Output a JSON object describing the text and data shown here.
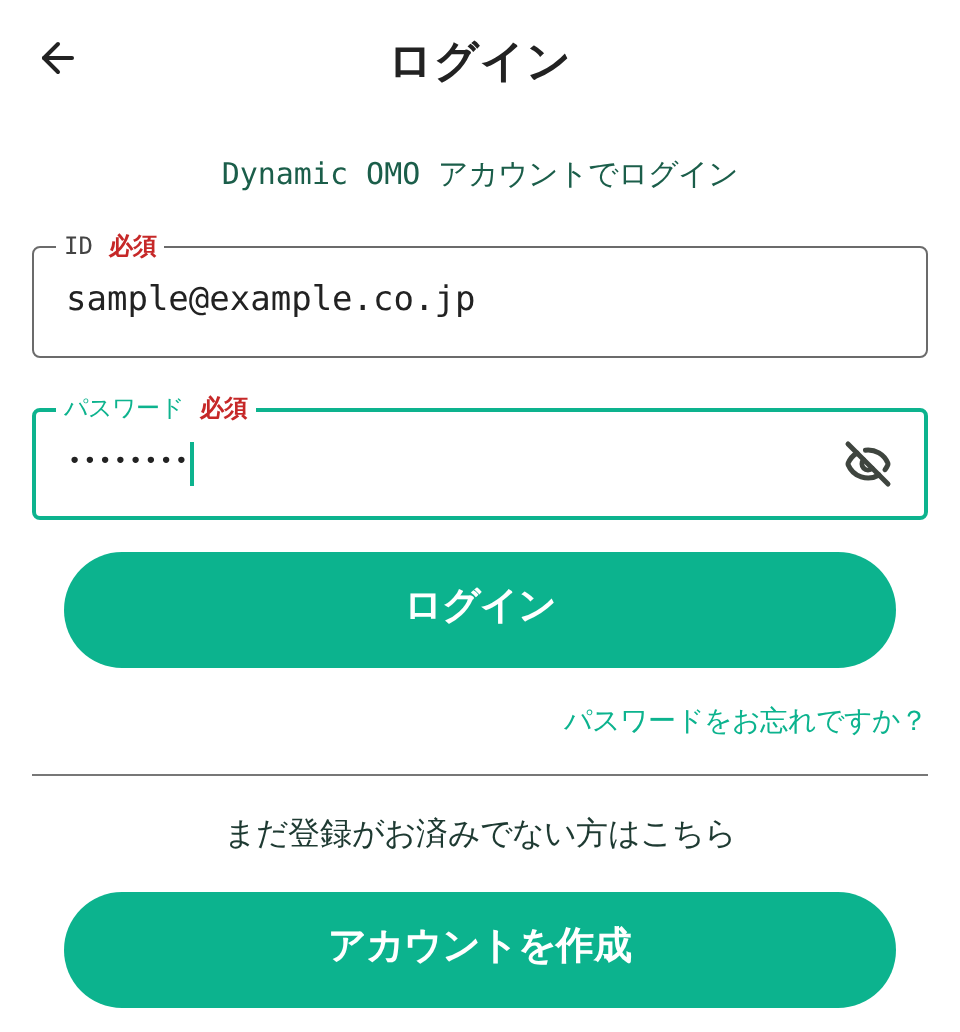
{
  "header": {
    "title": "ログイン"
  },
  "subtitle": "Dynamic OMO アカウントでログイン",
  "fields": [
    {
      "label": "ID",
      "required_mark": "必須",
      "value": "sample@example.co.jp",
      "focused": false,
      "kind": "text"
    },
    {
      "label": "パスワード",
      "required_mark": "必須",
      "value": "••••••••",
      "focused": true,
      "kind": "password"
    }
  ],
  "login_button": "ログイン",
  "forgot_link": "パスワードをお忘れですか？",
  "register_prompt": "まだ登録がお済みでない方はこちら",
  "create_account_button": "アカウントを作成"
}
